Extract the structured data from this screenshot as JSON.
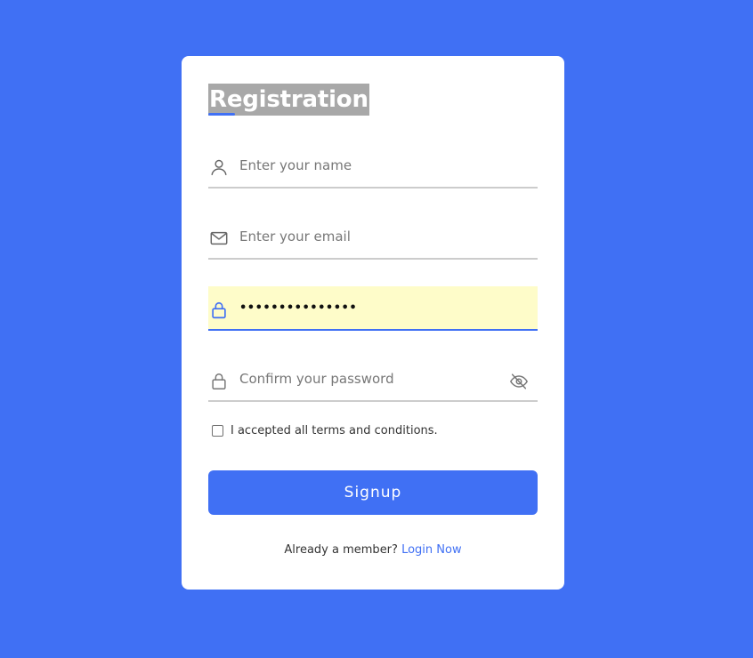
{
  "form": {
    "title": "Registration",
    "name_placeholder": "Enter your name",
    "email_placeholder": "Enter your email",
    "password_value_masked": "•••••••••••••••",
    "confirm_placeholder": "Confirm your password",
    "terms_label": "I accepted all terms and conditions.",
    "signup_label": "Signup",
    "member_text": "Already a member?",
    "login_label": "Login Now"
  },
  "icons": {
    "name": "user-icon",
    "email": "envelope-icon",
    "password": "lock-icon",
    "confirm": "lock-icon",
    "toggle_visibility": "eye-slash-icon"
  },
  "colors": {
    "accent": "#4070f4",
    "autofill_background": "#fefcc9",
    "card": "#ffffff"
  }
}
